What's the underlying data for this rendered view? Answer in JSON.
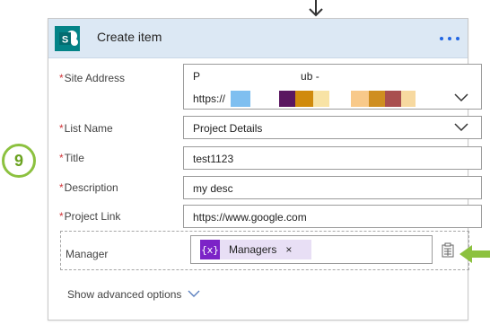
{
  "card": {
    "title": "Create item",
    "more_label": "···"
  },
  "fields": {
    "site_address": {
      "label": "Site Address",
      "line1": "P",
      "line1_tail": "ub -",
      "line2": "https://"
    },
    "list_name": {
      "label": "List Name",
      "value": "Project Details"
    },
    "title": {
      "label": "Title",
      "value": "test1123"
    },
    "description": {
      "label": "Description",
      "value": "my desc"
    },
    "project_link": {
      "label": "Project Link",
      "value": "https://www.google.com"
    },
    "manager": {
      "label": "Manager",
      "token_icon": "{x}",
      "token_label": "Managers",
      "token_remove": "×"
    }
  },
  "advanced": {
    "label": "Show advanced options"
  },
  "step_badge": "9",
  "colors": {
    "header_bg": "#dce8f4",
    "sharepoint": "#038387",
    "required": "#d13438",
    "token_bg": "#e8dff5",
    "token_icon_bg": "#7c23c7",
    "badge_green": "#8cc13f",
    "more_blue": "#2266e3"
  },
  "icons": {
    "header": "sharepoint-icon",
    "manager_picker": "dynamic-content-icon",
    "arrow": "arrow-down-icon",
    "pointer": "green-arrow-icon"
  }
}
